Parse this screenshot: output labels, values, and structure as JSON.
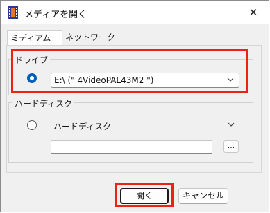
{
  "window": {
    "title": "メディアを開く",
    "close_glyph": "✕"
  },
  "tabs": [
    {
      "label": "ミディアム",
      "active": true
    },
    {
      "label": "ネットワーク",
      "active": false
    }
  ],
  "drive_group": {
    "label": "ドライブ",
    "selected": true,
    "combo_value": "E:\\ (\" 4VideoPAL43M2 \")"
  },
  "hdd_group": {
    "label": "ハードディスク",
    "selected": false,
    "combo_value": "ハードディスク",
    "path_value": "",
    "browse_label": "..."
  },
  "footer": {
    "open_label": "開く",
    "cancel_label": "キャンセル"
  },
  "colors": {
    "accent": "#005fb8",
    "highlight": "#ee2211"
  }
}
